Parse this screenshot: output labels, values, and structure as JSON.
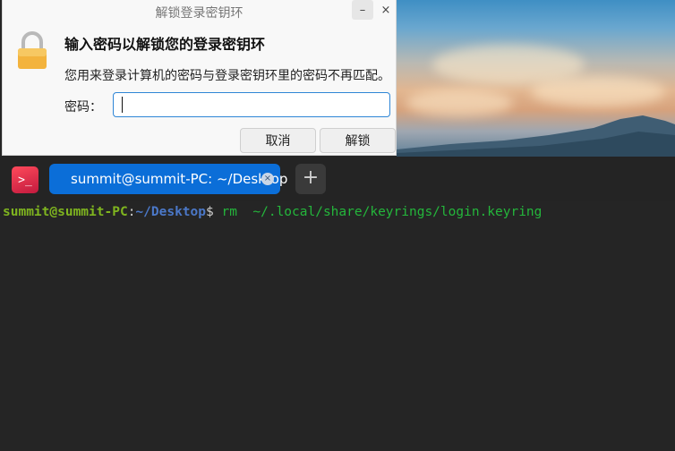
{
  "dialog": {
    "title": "解锁登录密钥环",
    "minimize_glyph": "–",
    "close_glyph": "×",
    "heading": "输入密码以解锁您的登录密钥环",
    "description": "您用来登录计算机的密码与登录密钥环里的密码不再匹配。",
    "password_label": "密码：",
    "password_value": "",
    "cancel_label": "取消",
    "unlock_label": "解锁",
    "icon": "lock-icon"
  },
  "terminal": {
    "app_icon_glyph": ">_",
    "tab_label": "summit@summit-PC: ~/Desktop",
    "tab_close_glyph": "×",
    "new_tab_glyph": "+",
    "prompt_user": "summit@summit-PC",
    "prompt_colon": ":",
    "prompt_path": "~/Desktop",
    "prompt_symbol": "$ ",
    "command": "rm  ~/.local/share/keyrings/login.keyring"
  },
  "colors": {
    "accent": "#0b6ed8",
    "terminal_bg": "#252525",
    "prompt_user": "#7fb51f",
    "prompt_path": "#4b78c8",
    "command": "#24b63b"
  }
}
